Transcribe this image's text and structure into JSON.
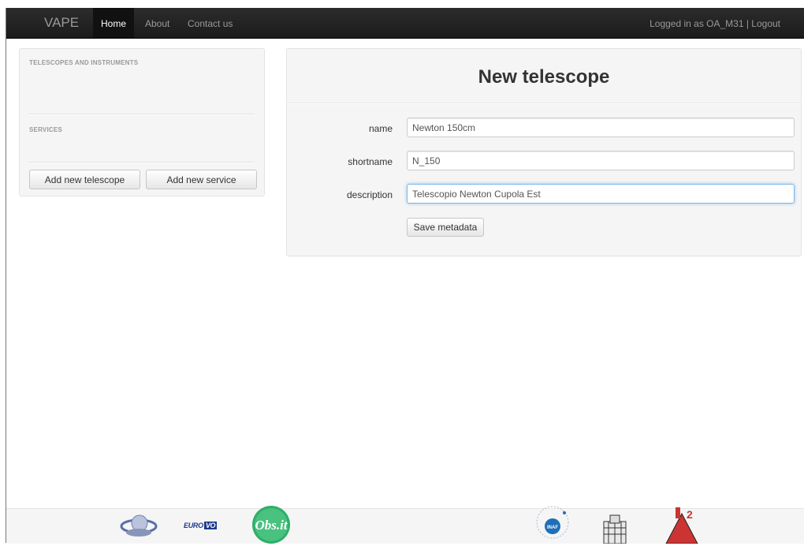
{
  "navbar": {
    "brand": "VAPE",
    "items": [
      {
        "label": "Home"
      },
      {
        "label": "About"
      },
      {
        "label": "Contact us"
      }
    ],
    "user": "Logged in as OA_M31 | Logout"
  },
  "sidebar": {
    "header_telescopes": "TELESCOPES AND INSTRUMENTS",
    "header_services": "SERVICES",
    "add_telescope_label": "Add new telescope",
    "add_service_label": "Add new service"
  },
  "form": {
    "title": "New telescope",
    "fields": [
      {
        "label": "name",
        "value": "Newton 150cm"
      },
      {
        "label": "shortname",
        "value": "N_150"
      },
      {
        "label": "description",
        "value": "Telescopio Newton Cupola Est"
      }
    ],
    "save_label": "Save metadata"
  },
  "footer": {
    "logos": [
      {
        "icon": "ivoa-logo"
      },
      {
        "icon": "eurovo-logo",
        "text_a": "EURO",
        "text_b": "VO"
      },
      {
        "icon": "obs-it-logo",
        "text": "Obs.it"
      },
      {
        "icon": "inaf-logo",
        "text": "INAF"
      },
      {
        "icon": "observatory-building-logo"
      },
      {
        "icon": "ia2-logo"
      }
    ]
  },
  "colors": {
    "navbar_bg": "#1b1b1b",
    "panel_bg": "#f5f5f5",
    "focus_border": "#7eb7e6"
  }
}
